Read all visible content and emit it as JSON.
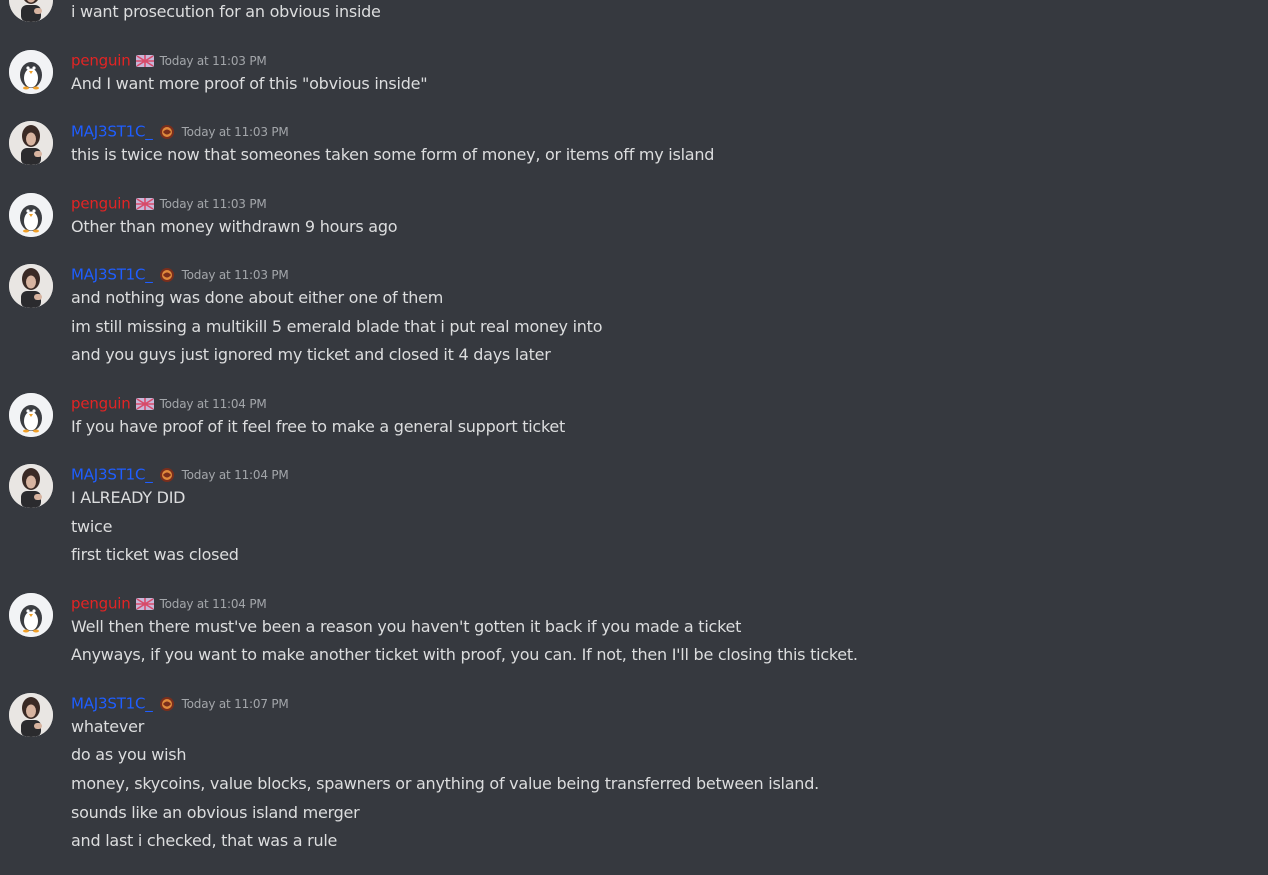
{
  "colors": {
    "background": "#36393f",
    "penguin_name": "#e32424",
    "majestic_name": "#1f5eff",
    "message_text": "#dcddde",
    "timestamp": "#a3a6aa"
  },
  "top_fragment": {
    "text": "i want prosecution for an obvious inside",
    "avatar_icon": "woman-avatar-icon"
  },
  "groups": [
    {
      "author": "penguin",
      "author_color": "#e32424",
      "role_icon": "flag-icon",
      "timestamp": "Today at 11:03 PM",
      "avatar_icon": "penguin-avatar-icon",
      "lines": [
        "And I want more proof of this \"obvious inside\""
      ]
    },
    {
      "author": "MAJ3ST1C_",
      "author_color": "#1f5eff",
      "role_icon": "globe-badge-icon",
      "timestamp": "Today at 11:03 PM",
      "avatar_icon": "woman-avatar-icon",
      "lines": [
        "this is twice now that someones taken some form of money, or items off my island"
      ]
    },
    {
      "author": "penguin",
      "author_color": "#e32424",
      "role_icon": "flag-icon",
      "timestamp": "Today at 11:03 PM",
      "avatar_icon": "penguin-avatar-icon",
      "lines": [
        "Other than money withdrawn 9 hours ago"
      ]
    },
    {
      "author": "MAJ3ST1C_",
      "author_color": "#1f5eff",
      "role_icon": "globe-badge-icon",
      "timestamp": "Today at 11:03 PM",
      "avatar_icon": "woman-avatar-icon",
      "lines": [
        "and nothing was done about either one of them",
        "im still missing a multikill 5 emerald blade that i put real money into",
        "and you guys just ignored my ticket and closed it 4 days later"
      ]
    },
    {
      "author": "penguin",
      "author_color": "#e32424",
      "role_icon": "flag-icon",
      "timestamp": "Today at 11:04 PM",
      "avatar_icon": "penguin-avatar-icon",
      "lines": [
        "If you have proof of it feel free to make a general support ticket"
      ]
    },
    {
      "author": "MAJ3ST1C_",
      "author_color": "#1f5eff",
      "role_icon": "globe-badge-icon",
      "timestamp": "Today at 11:04 PM",
      "avatar_icon": "woman-avatar-icon",
      "lines": [
        "I ALREADY DID",
        "twice",
        "first ticket was closed"
      ]
    },
    {
      "author": "penguin",
      "author_color": "#e32424",
      "role_icon": "flag-icon",
      "timestamp": "Today at 11:04 PM",
      "avatar_icon": "penguin-avatar-icon",
      "lines": [
        "Well then there must've been a reason you haven't gotten it back if you made a ticket",
        "Anyways, if you want to make another ticket with proof, you can. If not, then I'll be closing this ticket."
      ]
    },
    {
      "author": "MAJ3ST1C_",
      "author_color": "#1f5eff",
      "role_icon": "globe-badge-icon",
      "timestamp": "Today at 11:07 PM",
      "avatar_icon": "woman-avatar-icon",
      "lines": [
        "whatever",
        "do as you wish",
        "money, skycoins, value blocks, spawners or anything of value being transferred between island.",
        "sounds like an obvious island merger",
        "and last i checked, that was a rule"
      ]
    }
  ]
}
